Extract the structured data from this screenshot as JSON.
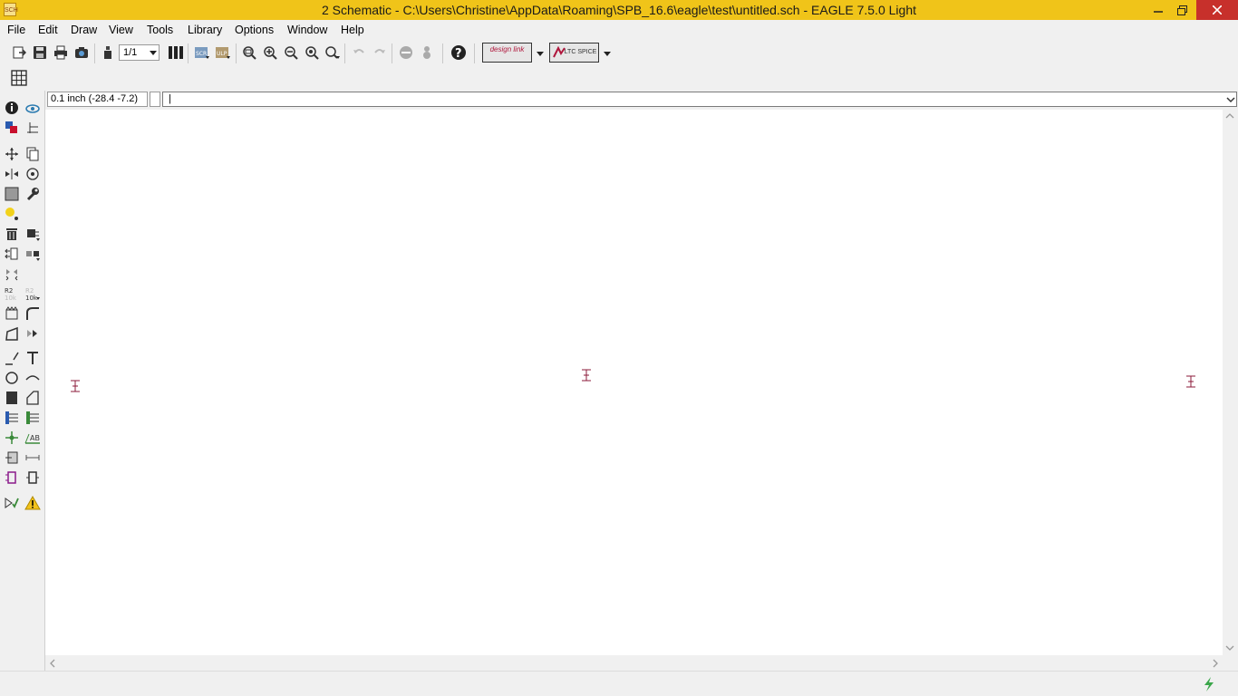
{
  "window": {
    "title": "2 Schematic - C:\\Users\\Christine\\AppData\\Roaming\\SPB_16.6\\eagle\\test\\untitled.sch - EAGLE 7.5.0 Light",
    "app_icon_label": "SCH"
  },
  "menu": {
    "items": [
      {
        "label": "File"
      },
      {
        "label": "Edit"
      },
      {
        "label": "Draw"
      },
      {
        "label": "View"
      },
      {
        "label": "Tools"
      },
      {
        "label": "Library"
      },
      {
        "label": "Options"
      },
      {
        "label": "Window"
      },
      {
        "label": "Help"
      }
    ]
  },
  "toolbar": {
    "sheet_select": "1/1",
    "designlink_label": "design link",
    "ltspice_label": "LTC SPICE"
  },
  "coord_bar": {
    "coordinate": "0.1 inch (-28.4 -7.2)",
    "command_value": "|"
  },
  "colors": {
    "titlebar": "#f0c419",
    "close_button": "#c7302b",
    "frame_mark": "#8b1a3a",
    "canvas": "#ffffff"
  }
}
